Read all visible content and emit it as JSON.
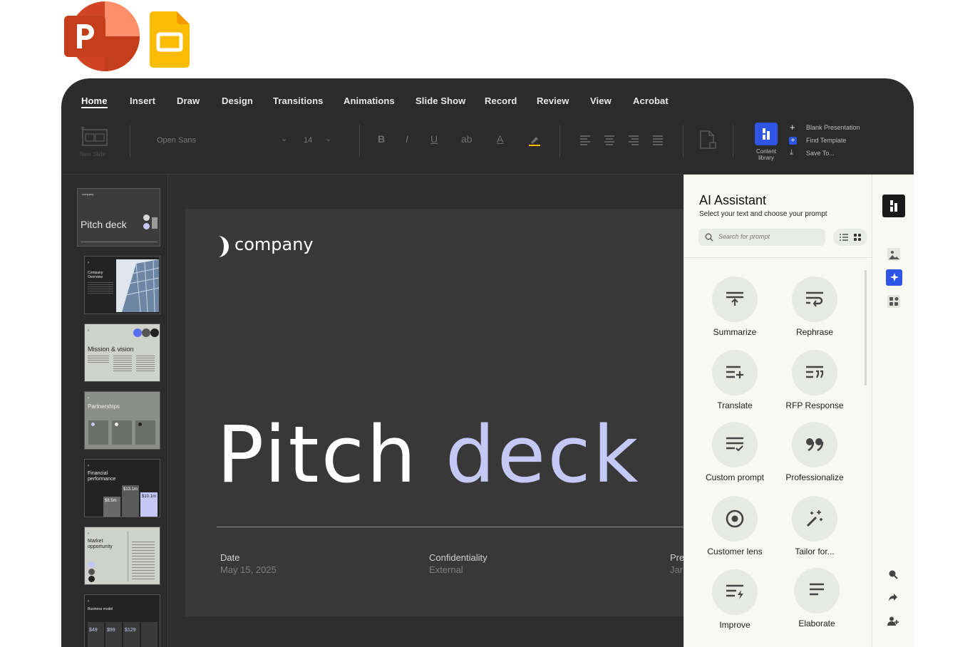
{
  "ribbon_tabs": [
    "Home",
    "Insert",
    "Draw",
    "Design",
    "Transitions",
    "Animations",
    "Slide Show",
    "Record",
    "Review",
    "View",
    "Acrobat"
  ],
  "toolbar": {
    "new_slide_label": "New Slide",
    "font_name": "Open Sans",
    "font_size": "14",
    "bold": "B",
    "italic": "I",
    "underline": "U",
    "strikethrough": "ab",
    "font_color": "A",
    "content_library_label": "Content library",
    "quick_actions": [
      "Blank Presentation",
      "Find Template",
      "Save To..."
    ]
  },
  "thumbnails": {
    "slide1_brand": "company",
    "slide1_title": "Pitch deck",
    "slide2_title": "Company Overview",
    "slide3_title": "Mission & vision",
    "slide4_title": "Partnerships",
    "slide5_title": "Financial performance",
    "slide5_values": [
      "$8.5m",
      "$13.1m",
      "$10.1m"
    ],
    "slide6_title": "Market opportunity",
    "slide7_title": "Business model",
    "slide7_values": [
      "$49",
      "$99",
      "$129"
    ]
  },
  "slide": {
    "brand": "company",
    "title_word1": "Pitch",
    "title_word2": "deck",
    "meta": [
      {
        "label": "Date",
        "value": "May 15, 2025"
      },
      {
        "label": "Confidentiality",
        "value": "External"
      },
      {
        "label": "Pre",
        "value": "Jar"
      }
    ]
  },
  "ai_assistant": {
    "title": "AI Assistant",
    "subtitle": "Select your text and choose your prompt",
    "search_placeholder": "Search for prompt",
    "prompts": [
      "Summarize",
      "Rephrase",
      "Translate",
      "RFP Response",
      "Custom prompt",
      "Professionalize",
      "Customer lens",
      "Tailor for...",
      "Improve",
      "Elaborate"
    ]
  },
  "colors": {
    "window_bg": "#2b2b2b",
    "slide_bg": "#383838",
    "accent_lavender": "#c4c8f4",
    "accent_blue": "#2f55e4",
    "panel_bg": "#f7f9f2",
    "powerpoint_red": "#d04423",
    "slides_yellow": "#fbbc04"
  }
}
